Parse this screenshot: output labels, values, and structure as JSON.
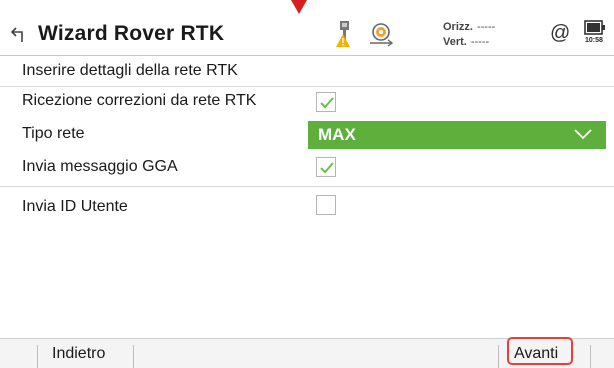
{
  "header": {
    "title": "Wizard Rover RTK",
    "quality_h_label": "Orizz.",
    "quality_h_value": "-----",
    "quality_v_label": "Vert.",
    "quality_v_value": "-----",
    "at_symbol": "@",
    "time": "10:58"
  },
  "main": {
    "intro": "Inserire dettagli della rete RTK",
    "rows": [
      {
        "label": "Ricezione correzioni da rete RTK",
        "checked": true
      },
      {
        "label": "Tipo rete",
        "value": "MAX"
      },
      {
        "label": "Invia messaggio GGA",
        "checked": true
      },
      {
        "label": "Invia ID Utente",
        "checked": false
      }
    ]
  },
  "footer": {
    "back_label": "Indietro",
    "next_label": "Avanti"
  },
  "colors": {
    "accent_green": "#5faf3c",
    "check_green": "#6cbf45",
    "highlight_red": "#e04040"
  },
  "icons": [
    "back-arrow-icon",
    "rover-warning-icon",
    "target-icon",
    "at-icon",
    "battery-icon",
    "check-icon",
    "chevron-down-icon"
  ]
}
